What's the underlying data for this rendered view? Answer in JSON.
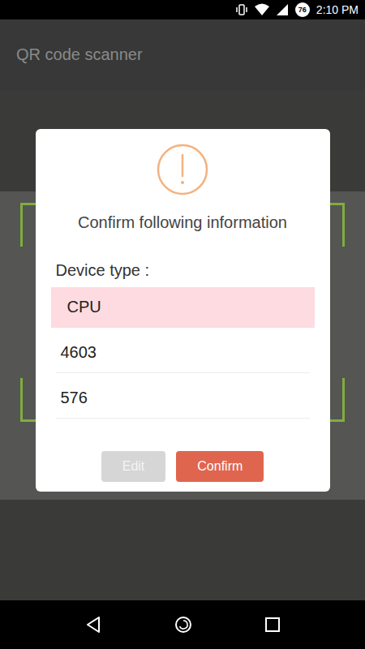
{
  "status_bar": {
    "battery": "76",
    "time": "2:10 PM"
  },
  "app_bar": {
    "title": "QR code scanner"
  },
  "dialog": {
    "title": "Confirm following information",
    "label": "Device type :",
    "options": [
      {
        "label": "CPU",
        "selected": true
      },
      {
        "label": "4603",
        "selected": false
      },
      {
        "label": "576",
        "selected": false
      }
    ],
    "buttons": [
      {
        "label": "Edit",
        "kind": "secondary",
        "disabled": true
      },
      {
        "label": "Confirm",
        "kind": "primary",
        "disabled": false
      }
    ]
  }
}
